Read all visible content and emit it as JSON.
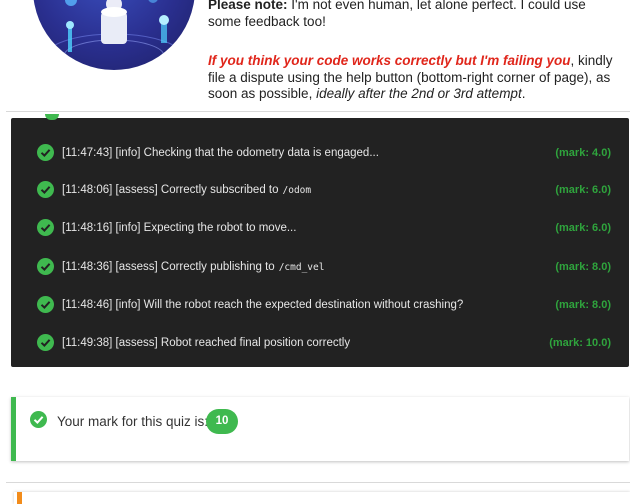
{
  "note": {
    "line1_bold": "Please note:",
    "line1_rest": " I'm not even human, let alone perfect. I could use some feedback too!",
    "line2_red": "If you think your code works correctly but I'm failing you",
    "line2_mid": ", kindly file a dispute using the help button (bottom-right corner of page), as soon as possible, ",
    "line2_italic": "ideally after the 2nd or 3rd attempt",
    "line2_end": "."
  },
  "log": {
    "rows": [
      {
        "time": "[11:47:43]",
        "level": "[info]",
        "message": "Checking that the odometry data is engaged...",
        "code": "",
        "mark": "(mark: 4.0)"
      },
      {
        "time": "[11:48:06]",
        "level": "[assess]",
        "message": "Correctly subscribed to",
        "code": "/odom",
        "mark": "(mark: 6.0)"
      },
      {
        "time": "[11:48:16]",
        "level": "[info]",
        "message": "Expecting the robot to move...",
        "code": "",
        "mark": "(mark: 6.0)"
      },
      {
        "time": "[11:48:36]",
        "level": "[assess]",
        "message": "Correctly publishing to",
        "code": "/cmd_vel",
        "mark": "(mark: 8.0)"
      },
      {
        "time": "[11:48:46]",
        "level": "[info]",
        "message": "Will the robot reach the expected destination without crashing?",
        "code": "",
        "mark": "(mark: 8.0)"
      },
      {
        "time": "[11:49:38]",
        "level": "[assess]",
        "message": "Robot reached final position correctly",
        "code": "",
        "mark": "(mark: 10.0)"
      }
    ]
  },
  "result": {
    "label": "Your mark for this quiz is:",
    "score": "10"
  },
  "colors": {
    "success": "#3fb94f",
    "panel_bg": "#222222",
    "warning_red": "#e0261b",
    "mark_green": "#2fa43d",
    "accent_orange": "#f28c1b"
  }
}
